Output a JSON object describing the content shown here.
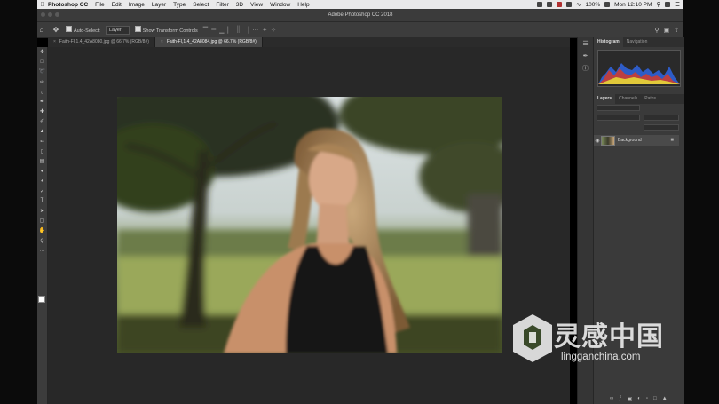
{
  "menubar": {
    "app": "Photoshop CC",
    "menus": [
      "File",
      "Edit",
      "Image",
      "Layer",
      "Type",
      "Select",
      "Filter",
      "3D",
      "View",
      "Window",
      "Help"
    ],
    "battery": "100%",
    "clock": "Mon 12:10 PM"
  },
  "window": {
    "title": "Adobe Photoshop CC 2018"
  },
  "options": {
    "auto_select_label": "Auto-Select:",
    "auto_select_value": "Layer",
    "transform_label": "Show Transform Controls"
  },
  "tabs": [
    {
      "label": "Faith-FI,1.4_42A8080.jpg @ 66.7% (RGB/8#)"
    },
    {
      "label": "Faith-FI,1.4_42A8084.jpg @ 66.7% (RGB/8#)"
    }
  ],
  "panels": {
    "top_tabs": [
      "Histogram",
      "Navigation"
    ],
    "layer_tabs": [
      "Layers",
      "Channels",
      "Paths"
    ],
    "layer_name": "Background"
  },
  "watermark": {
    "title": "灵感中国",
    "url": "lingganchina.com"
  },
  "colors": {
    "accent": "#3a3a3a",
    "canvas": "#282828"
  }
}
